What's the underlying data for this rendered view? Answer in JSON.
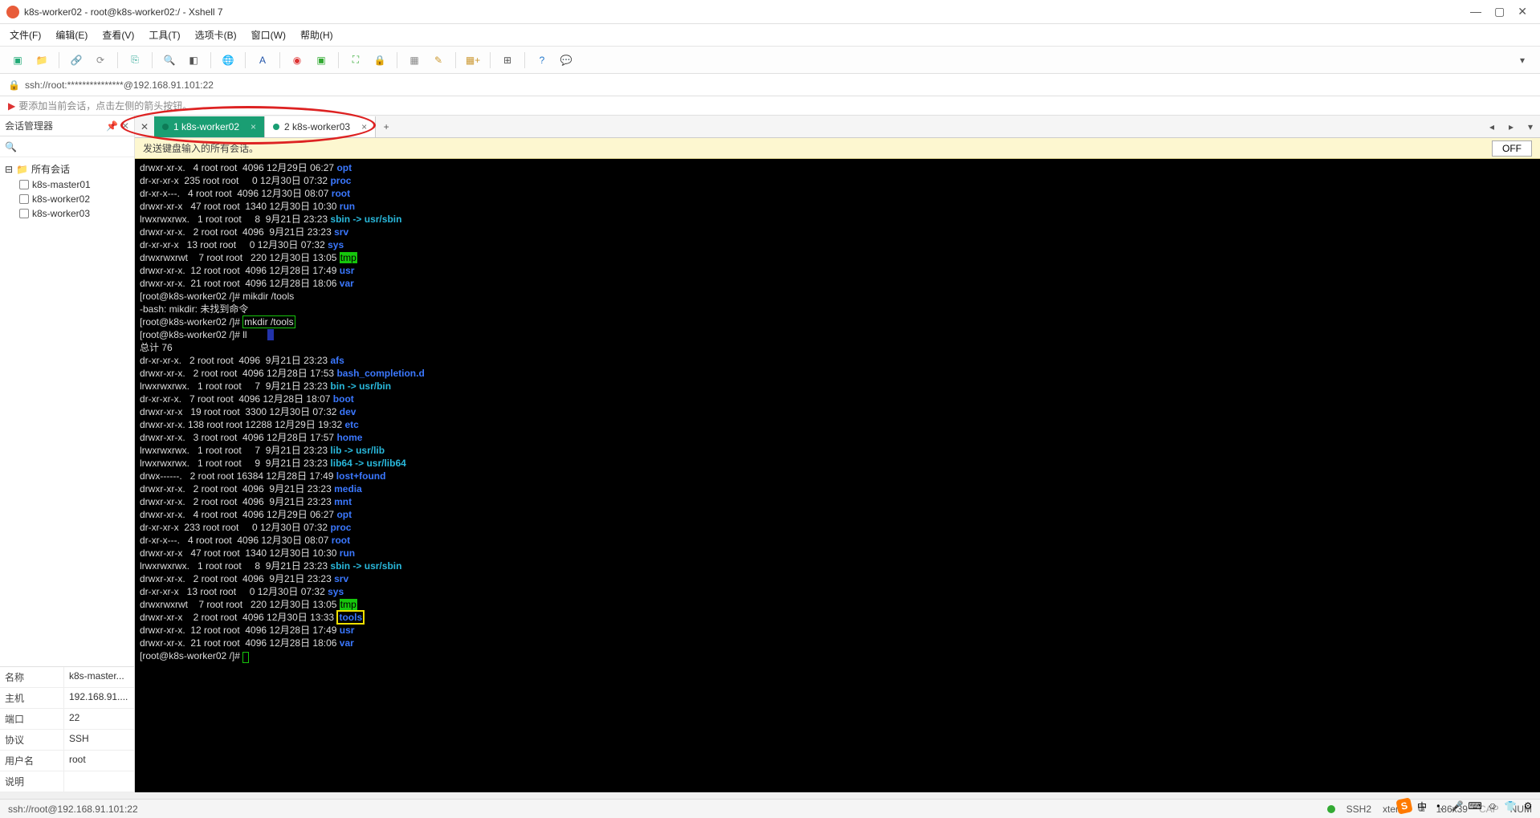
{
  "window": {
    "title": "k8s-worker02 - root@k8s-worker02:/ - Xshell 7"
  },
  "menu": {
    "file": "文件(F)",
    "edit": "编辑(E)",
    "view": "查看(V)",
    "tools": "工具(T)",
    "tabs": "选项卡(B)",
    "window": "窗口(W)",
    "help": "帮助(H)"
  },
  "address": {
    "url": "ssh://root:***************@192.168.91.101:22"
  },
  "tip": {
    "text": "要添加当前会话，点击左侧的箭头按钮。"
  },
  "sidebar": {
    "title": "会话管理器",
    "root": "所有会话",
    "items": [
      "k8s-master01",
      "k8s-worker02",
      "k8s-worker03"
    ],
    "props": {
      "name_k": "名称",
      "name_v": "k8s-master...",
      "host_k": "主机",
      "host_v": "192.168.91....",
      "port_k": "端口",
      "port_v": "22",
      "proto_k": "协议",
      "proto_v": "SSH",
      "user_k": "用户名",
      "user_v": "root",
      "desc_k": "说明",
      "desc_v": ""
    }
  },
  "tabs": {
    "t1": "1 k8s-worker02",
    "t2": "2 k8s-worker03"
  },
  "broadcast": {
    "text": "发送键盘输入的所有会话。",
    "off": "OFF"
  },
  "term": {
    "lines_top": [
      {
        "perm": "drwxr-xr-x.",
        "n": "  4",
        "own": "root root",
        "sz": " 4096",
        "date": "12月29日",
        "time": "06:27",
        "name": "opt",
        "cls": "t-blue"
      },
      {
        "perm": "dr-xr-xr-x ",
        "n": "235",
        "own": "root root",
        "sz": "    0",
        "date": "12月30日",
        "time": "07:32",
        "name": "proc",
        "cls": "t-blue"
      },
      {
        "perm": "dr-xr-x---.",
        "n": "  4",
        "own": "root root",
        "sz": " 4096",
        "date": "12月30日",
        "time": "08:07",
        "name": "root",
        "cls": "t-blue"
      },
      {
        "perm": "drwxr-xr-x ",
        "n": " 47",
        "own": "root root",
        "sz": " 1340",
        "date": "12月30日",
        "time": "10:30",
        "name": "run",
        "cls": "t-blue"
      },
      {
        "perm": "lrwxrwxrwx.",
        "n": "  1",
        "own": "root root",
        "sz": "    8",
        "date": " 9月21日",
        "time": "23:23",
        "name": "sbin -> usr/sbin",
        "cls": "t-cyan"
      },
      {
        "perm": "drwxr-xr-x.",
        "n": "  2",
        "own": "root root",
        "sz": " 4096",
        "date": " 9月21日",
        "time": "23:23",
        "name": "srv",
        "cls": "t-blue"
      },
      {
        "perm": "dr-xr-xr-x ",
        "n": " 13",
        "own": "root root",
        "sz": "    0",
        "date": "12月30日",
        "time": "07:32",
        "name": "sys",
        "cls": "t-blue"
      },
      {
        "perm": "drwxrwxrwt ",
        "n": "  7",
        "own": "root root",
        "sz": "  220",
        "date": "12月30日",
        "time": "13:05",
        "name": "tmp",
        "cls": "t-tmp"
      },
      {
        "perm": "drwxr-xr-x.",
        "n": " 12",
        "own": "root root",
        "sz": " 4096",
        "date": "12月28日",
        "time": "17:49",
        "name": "usr",
        "cls": "t-blue"
      },
      {
        "perm": "drwxr-xr-x.",
        "n": " 21",
        "own": "root root",
        "sz": " 4096",
        "date": "12月28日",
        "time": "18:06",
        "name": "var",
        "cls": "t-blue"
      }
    ],
    "prompt1": "[root@k8s-worker02 /]# mikdir /tools",
    "err1": "-bash: mikdir: 未找到命令",
    "prompt2_pre": "[root@k8s-worker02 /]# ",
    "prompt2_cmd": "mkdir /tools",
    "prompt3": "[root@k8s-worker02 /]# ll",
    "total": "总计 76",
    "lines_bot": [
      {
        "perm": "dr-xr-xr-x.",
        "n": "  2",
        "own": "root root",
        "sz": " 4096",
        "date": " 9月21日",
        "time": "23:23",
        "name": "afs",
        "cls": "t-blue"
      },
      {
        "perm": "drwxr-xr-x.",
        "n": "  2",
        "own": "root root",
        "sz": " 4096",
        "date": "12月28日",
        "time": "17:53",
        "name": "bash_completion.d",
        "cls": "t-blue"
      },
      {
        "perm": "lrwxrwxrwx.",
        "n": "  1",
        "own": "root root",
        "sz": "    7",
        "date": " 9月21日",
        "time": "23:23",
        "name": "bin -> usr/bin",
        "cls": "t-cyan"
      },
      {
        "perm": "dr-xr-xr-x.",
        "n": "  7",
        "own": "root root",
        "sz": " 4096",
        "date": "12月28日",
        "time": "18:07",
        "name": "boot",
        "cls": "t-blue"
      },
      {
        "perm": "drwxr-xr-x ",
        "n": " 19",
        "own": "root root",
        "sz": " 3300",
        "date": "12月30日",
        "time": "07:32",
        "name": "dev",
        "cls": "t-blue"
      },
      {
        "perm": "drwxr-xr-x.",
        "n": "138",
        "own": "root root",
        "sz": "12288",
        "date": "12月29日",
        "time": "19:32",
        "name": "etc",
        "cls": "t-blue"
      },
      {
        "perm": "drwxr-xr-x.",
        "n": "  3",
        "own": "root root",
        "sz": " 4096",
        "date": "12月28日",
        "time": "17:57",
        "name": "home",
        "cls": "t-blue"
      },
      {
        "perm": "lrwxrwxrwx.",
        "n": "  1",
        "own": "root root",
        "sz": "    7",
        "date": " 9月21日",
        "time": "23:23",
        "name": "lib -> usr/lib",
        "cls": "t-cyan"
      },
      {
        "perm": "lrwxrwxrwx.",
        "n": "  1",
        "own": "root root",
        "sz": "    9",
        "date": " 9月21日",
        "time": "23:23",
        "name": "lib64 -> usr/lib64",
        "cls": "t-cyan"
      },
      {
        "perm": "drwx------.",
        "n": "  2",
        "own": "root root",
        "sz": "16384",
        "date": "12月28日",
        "time": "17:49",
        "name": "lost+found",
        "cls": "t-blue"
      },
      {
        "perm": "drwxr-xr-x.",
        "n": "  2",
        "own": "root root",
        "sz": " 4096",
        "date": " 9月21日",
        "time": "23:23",
        "name": "media",
        "cls": "t-blue"
      },
      {
        "perm": "drwxr-xr-x.",
        "n": "  2",
        "own": "root root",
        "sz": " 4096",
        "date": " 9月21日",
        "time": "23:23",
        "name": "mnt",
        "cls": "t-blue"
      },
      {
        "perm": "drwxr-xr-x.",
        "n": "  4",
        "own": "root root",
        "sz": " 4096",
        "date": "12月29日",
        "time": "06:27",
        "name": "opt",
        "cls": "t-blue"
      },
      {
        "perm": "dr-xr-xr-x ",
        "n": "233",
        "own": "root root",
        "sz": "    0",
        "date": "12月30日",
        "time": "07:32",
        "name": "proc",
        "cls": "t-blue"
      },
      {
        "perm": "dr-xr-x---.",
        "n": "  4",
        "own": "root root",
        "sz": " 4096",
        "date": "12月30日",
        "time": "08:07",
        "name": "root",
        "cls": "t-blue"
      },
      {
        "perm": "drwxr-xr-x ",
        "n": " 47",
        "own": "root root",
        "sz": " 1340",
        "date": "12月30日",
        "time": "10:30",
        "name": "run",
        "cls": "t-blue"
      },
      {
        "perm": "lrwxrwxrwx.",
        "n": "  1",
        "own": "root root",
        "sz": "    8",
        "date": " 9月21日",
        "time": "23:23",
        "name": "sbin -> usr/sbin",
        "cls": "t-cyan"
      },
      {
        "perm": "drwxr-xr-x.",
        "n": "  2",
        "own": "root root",
        "sz": " 4096",
        "date": " 9月21日",
        "time": "23:23",
        "name": "srv",
        "cls": "t-blue"
      },
      {
        "perm": "dr-xr-xr-x ",
        "n": " 13",
        "own": "root root",
        "sz": "    0",
        "date": "12月30日",
        "time": "07:32",
        "name": "sys",
        "cls": "t-blue"
      },
      {
        "perm": "drwxrwxrwt ",
        "n": "  7",
        "own": "root root",
        "sz": "  220",
        "date": "12月30日",
        "time": "13:05",
        "name": "tmp",
        "cls": "t-tmp"
      },
      {
        "perm": "drwxr-xr-x ",
        "n": "  2",
        "own": "root root",
        "sz": " 4096",
        "date": "12月30日",
        "time": "13:33",
        "name": "tools",
        "cls": "t-hl-yellow"
      },
      {
        "perm": "drwxr-xr-x.",
        "n": " 12",
        "own": "root root",
        "sz": " 4096",
        "date": "12月28日",
        "time": "17:49",
        "name": "usr",
        "cls": "t-blue"
      },
      {
        "perm": "drwxr-xr-x.",
        "n": " 21",
        "own": "root root",
        "sz": " 4096",
        "date": "12月28日",
        "time": "18:06",
        "name": "var",
        "cls": "t-blue"
      }
    ],
    "prompt_end": "[root@k8s-worker02 /]# "
  },
  "status": {
    "left": "ssh://root@192.168.91.101:22",
    "ssh": "SSH2",
    "term": "xterm",
    "size": "186x39",
    "cap": "CAP",
    "num": "NUM"
  }
}
